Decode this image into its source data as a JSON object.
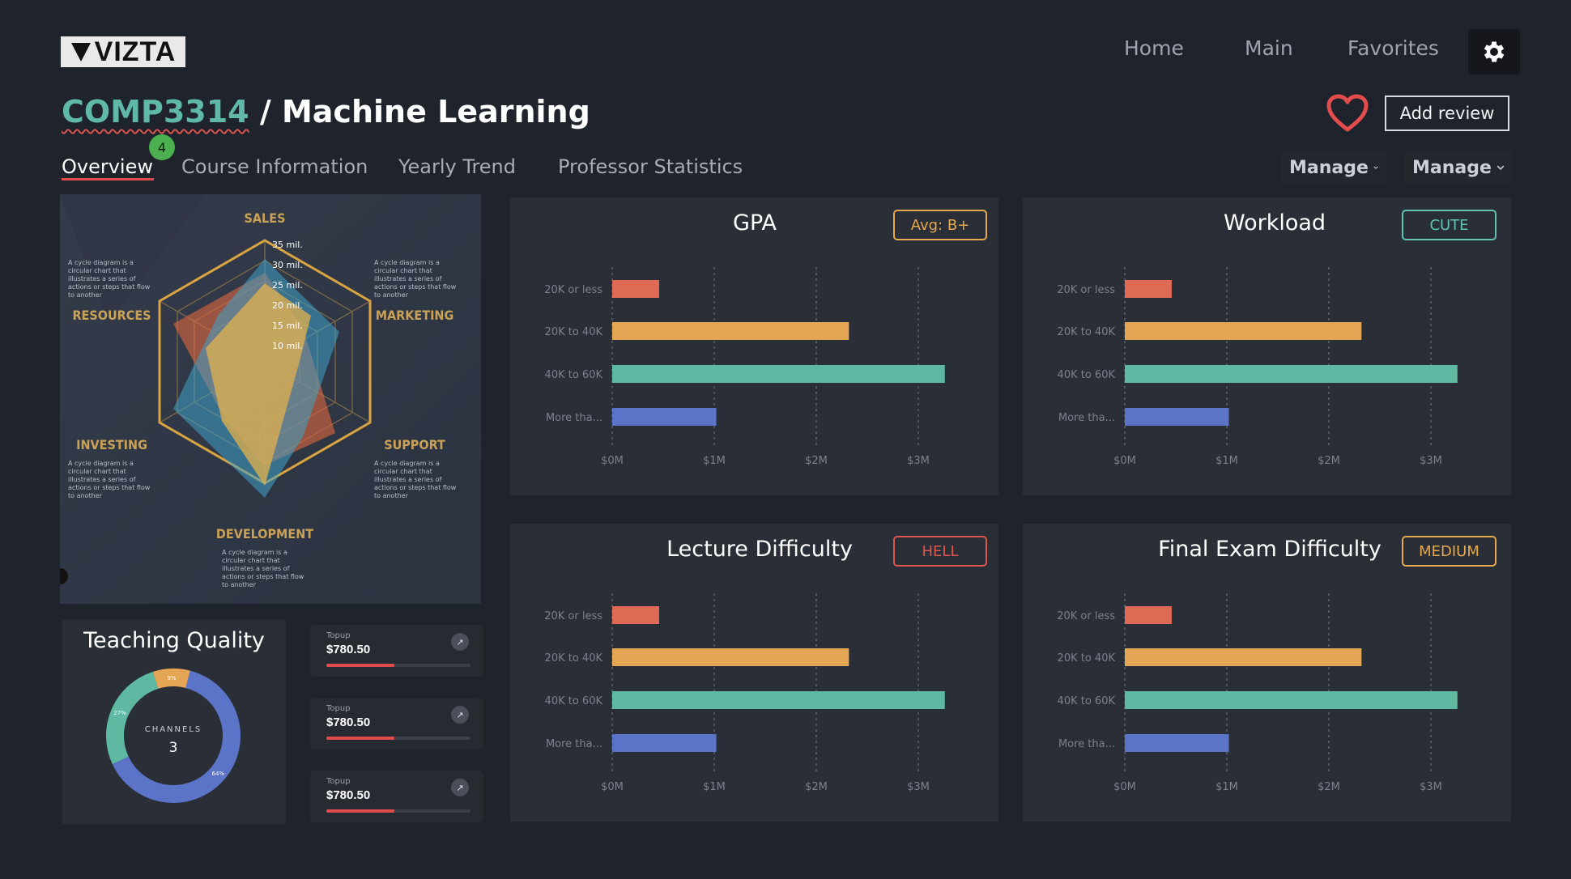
{
  "header": {
    "logo": "VIZTA",
    "nav": [
      "Home",
      "Main",
      "Favorites"
    ],
    "settings_icon": "gear-icon"
  },
  "course": {
    "code": "COMP3314",
    "separator": " / ",
    "name": "Machine Learning",
    "add_review": "Add review",
    "favorite_icon": "heart-icon"
  },
  "tabs": {
    "items": [
      "Overview",
      "Course Information",
      "Yearly Trend",
      "Professor Statistics"
    ],
    "active": 0,
    "badge": "4"
  },
  "manage": [
    "Manage",
    "Manage"
  ],
  "radar": {
    "axes": [
      "SALES",
      "MARKETING",
      "SUPPORT",
      "DEVELOPMENT",
      "INVESTING",
      "RESOURCES"
    ],
    "rings": [
      "35 mil.",
      "30 mil.",
      "25 mil.",
      "20 mil.",
      "15 mil.",
      "10 mil."
    ],
    "caption": "A cycle diagram is a circular chart that illustrates a series of actions or steps that flow to another"
  },
  "bar_charts": [
    {
      "title": "GPA",
      "chip": "Avg: B+",
      "chip_color": "#e8a84c"
    },
    {
      "title": "Workload",
      "chip": "CUTE",
      "chip_color": "#5fc4b0"
    },
    {
      "title": "Lecture Difficulty",
      "chip": "HELL",
      "chip_color": "#e0564f"
    },
    {
      "title": "Final Exam Difficulty",
      "chip": "MEDIUM",
      "chip_color": "#e8a84c"
    }
  ],
  "chart_data": [
    {
      "type": "bar",
      "orientation": "horizontal",
      "title": "GPA",
      "categories": [
        "20K or less",
        "20K to 40K",
        "40K to 60K",
        "More tha..."
      ],
      "values": [
        0.46,
        2.32,
        3.26,
        1.02
      ],
      "xticks": [
        "$0M",
        "$1M",
        "$2M",
        "$3M"
      ],
      "xlim": [
        0,
        3.3
      ],
      "grid": "vertical-dashed",
      "colors": [
        "#df6a55",
        "#e4a555",
        "#5fb9a2",
        "#5c74c8"
      ]
    },
    {
      "type": "bar",
      "orientation": "horizontal",
      "title": "Workload",
      "categories": [
        "20K or less",
        "20K to 40K",
        "40K to 60K",
        "More tha..."
      ],
      "values": [
        0.46,
        2.32,
        3.26,
        1.02
      ],
      "xticks": [
        "$0M",
        "$1M",
        "$2M",
        "$3M"
      ],
      "xlim": [
        0,
        3.3
      ],
      "grid": "vertical-dashed",
      "colors": [
        "#df6a55",
        "#e4a555",
        "#5fb9a2",
        "#5c74c8"
      ]
    },
    {
      "type": "bar",
      "orientation": "horizontal",
      "title": "Lecture Difficulty",
      "categories": [
        "20K or less",
        "20K to 40K",
        "40K to 60K",
        "More tha..."
      ],
      "values": [
        0.46,
        2.32,
        3.26,
        1.02
      ],
      "xticks": [
        "$0M",
        "$1M",
        "$2M",
        "$3M"
      ],
      "xlim": [
        0,
        3.3
      ],
      "grid": "vertical-dashed",
      "colors": [
        "#df6a55",
        "#e4a555",
        "#5fb9a2",
        "#5c74c8"
      ]
    },
    {
      "type": "bar",
      "orientation": "horizontal",
      "title": "Final Exam Difficulty",
      "categories": [
        "20K or less",
        "20K to 40K",
        "40K to 60K",
        "More tha..."
      ],
      "values": [
        0.46,
        2.32,
        3.26,
        1.02
      ],
      "xticks": [
        "$0M",
        "$1M",
        "$2M",
        "$3M"
      ],
      "xlim": [
        0,
        3.3
      ],
      "grid": "vertical-dashed",
      "colors": [
        "#df6a55",
        "#e4a555",
        "#5fb9a2",
        "#5c74c8"
      ]
    },
    {
      "type": "pie",
      "title": "Teaching Quality",
      "center_label": "CHANNELS",
      "center_value": "3",
      "slices": [
        {
          "label": "9%",
          "value": 9,
          "color": "#e4a555"
        },
        {
          "label": "64%",
          "value": 64,
          "color": "#5c74c8"
        },
        {
          "label": "27%",
          "value": 27,
          "color": "#5fb9a2"
        }
      ]
    }
  ],
  "teaching_quality": {
    "title": "Teaching Quality",
    "center_label": "CHANNELS",
    "center_value": "3"
  },
  "topups": [
    {
      "label": "Topup",
      "amount": "$780.50",
      "progress": 0.47
    },
    {
      "label": "Topup",
      "amount": "$780.50",
      "progress": 0.47
    },
    {
      "label": "Topup",
      "amount": "$780.50",
      "progress": 0.47
    }
  ]
}
